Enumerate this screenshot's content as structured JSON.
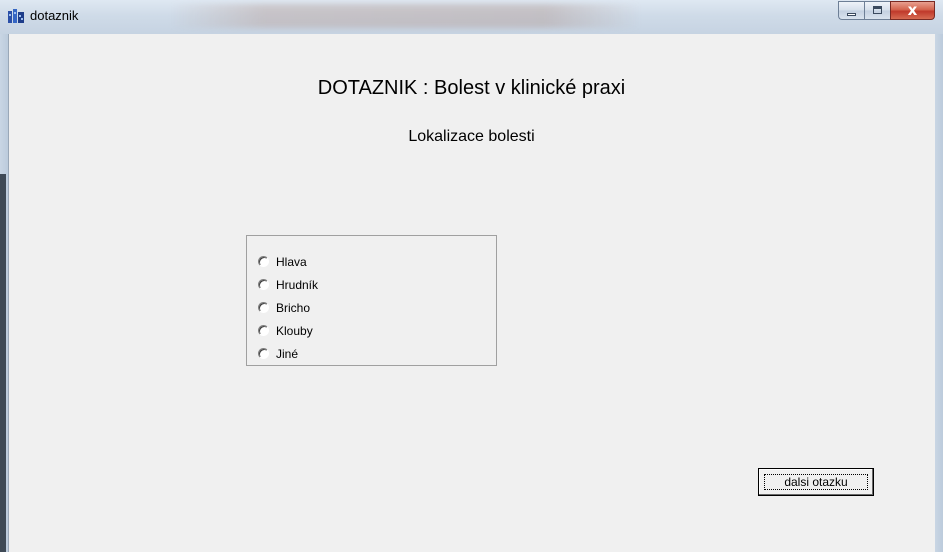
{
  "window": {
    "title": "dotaznik"
  },
  "window_controls": {
    "close_glyph": "x"
  },
  "form": {
    "heading": "DOTAZNIK : Bolest v klinické praxi",
    "subheading": "Lokalizace bolesti",
    "options": [
      "Hlava",
      "Hrudník",
      "Bricho",
      "Klouby",
      "Jiné"
    ],
    "next_button_label": "dalsi otazku"
  },
  "colors": {
    "client_background": "#f0f0f0",
    "titlebar": "#cfdbe8",
    "close_button": "#c0392b"
  },
  "icons": [
    "app-icon",
    "minimize-icon",
    "maximize-icon",
    "close-icon"
  ]
}
